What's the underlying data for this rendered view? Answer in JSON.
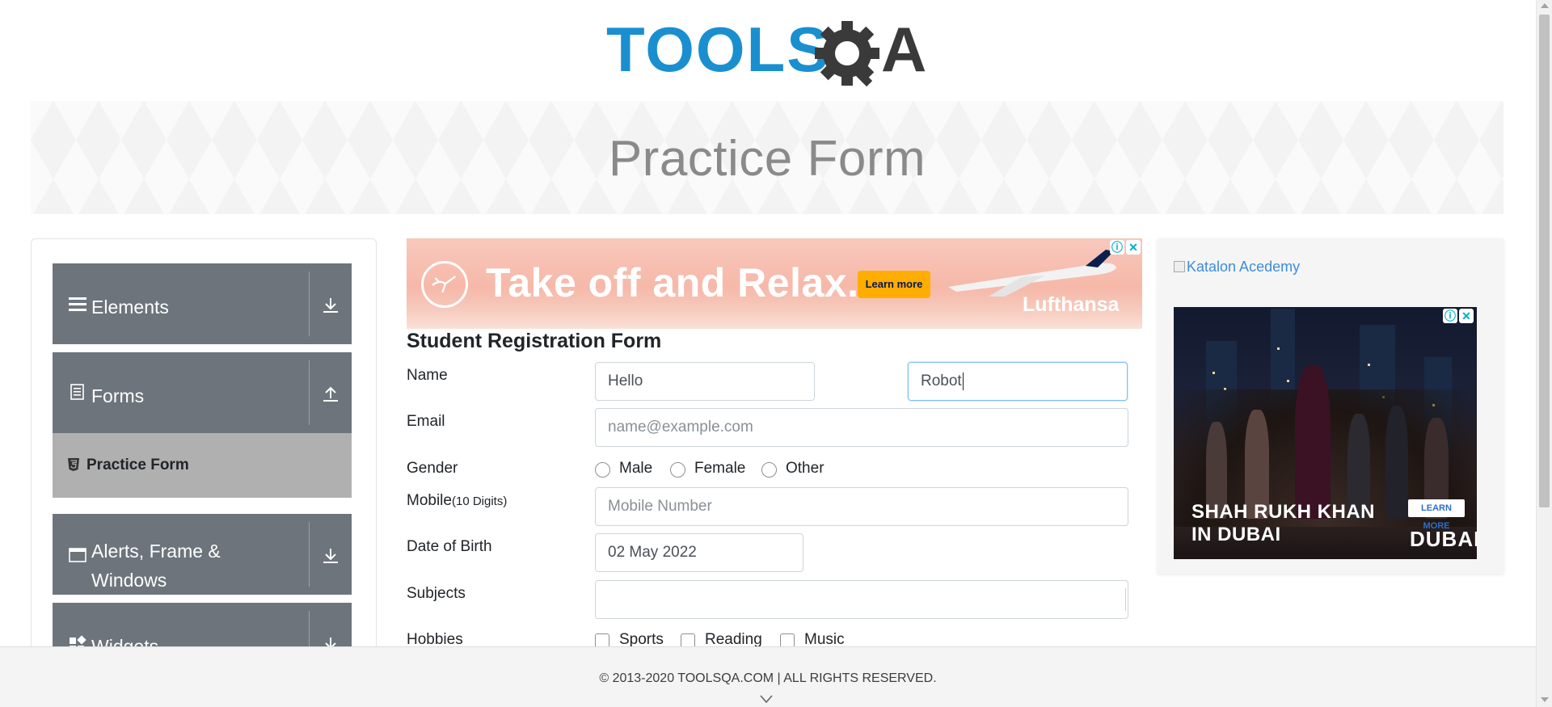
{
  "header": {
    "logo_text_left": "TOOLS",
    "logo_text_right": "A",
    "colors": {
      "logo_blue": "#1a8fd0",
      "logo_dark": "#3a3a3a"
    }
  },
  "banner": {
    "title": "Practice Form"
  },
  "sidebar": {
    "groups": [
      {
        "label": "Elements",
        "icon": "hamburger-icon",
        "action_icon": "download-arrow-icon"
      },
      {
        "label": "Forms",
        "icon": "document-icon",
        "action_icon": "upload-arrow-icon"
      },
      {
        "label": "Alerts, Frame &",
        "label_line2": "Windows",
        "icon": "window-icon",
        "action_icon": "download-arrow-icon"
      },
      {
        "label": "Widgets",
        "icon": "widgets-icon",
        "action_icon": "download-arrow-icon"
      }
    ],
    "active_subitem": {
      "label": "Practice Form",
      "icon": "html5-icon"
    },
    "colors": {
      "group_bg": "#6d747c",
      "active_bg": "#b0b0b0"
    }
  },
  "ad_top": {
    "headline": "Take off and Relax.",
    "button": "Learn more",
    "brand": "Lufthansa",
    "info_icon": "adchoices-icon",
    "close_icon": "close-icon"
  },
  "form": {
    "title": "Student Registration Form",
    "name_label": "Name",
    "first_name_value": "Hello",
    "last_name_value": "Robot",
    "email_label": "Email",
    "email_placeholder": "name@example.com",
    "gender_label": "Gender",
    "genders": [
      "Male",
      "Female",
      "Other"
    ],
    "mobile_label": "Mobile",
    "mobile_hint": "(10 Digits)",
    "mobile_placeholder": "Mobile Number",
    "dob_label": "Date of Birth",
    "dob_value": "02 May 2022",
    "subjects_label": "Subjects",
    "subjects_value": "",
    "hobbies_label": "Hobbies",
    "hobbies": [
      "Sports",
      "Reading",
      "Music"
    ]
  },
  "ad_right": {
    "broken_image_alt": "Katalon Acedemy",
    "line1": "SHAH RUKH KHAN",
    "line2": "IN DUBAI",
    "button": "LEARN MORE",
    "brand": "DUBAI"
  },
  "footer": {
    "copyright": "© 2013-2020 TOOLSQA.COM | ALL RIGHTS RESERVED."
  }
}
